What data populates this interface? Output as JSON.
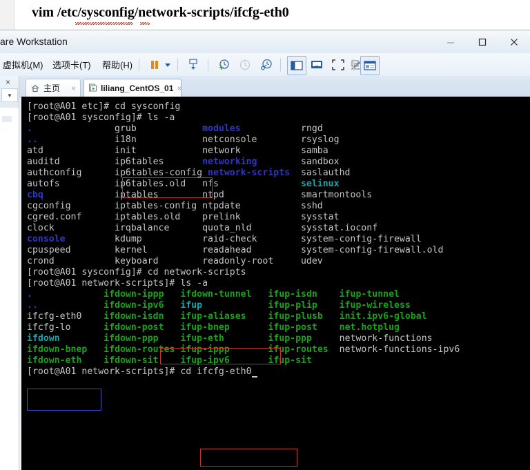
{
  "document": {
    "heading": "vim /etc/sysconfig/network-scripts/ifcfg-eth0"
  },
  "window": {
    "title": "are Workstation",
    "controls": {
      "minimize": "minimize-button",
      "maximize": "maximize-button",
      "close": "close-button"
    }
  },
  "menubar": {
    "items": [
      {
        "label": "虚拟机(M)"
      },
      {
        "label": "选项卡(T)"
      },
      {
        "label": "帮助(H)"
      }
    ],
    "toolbar_icons": [
      "pause-icon",
      "chevron-down-icon",
      "snapshot-icon",
      "take-snapshot-icon",
      "revert-snapshot-icon",
      "snapshot-manager-icon",
      "show-library-icon",
      "fit-window-icon",
      "full-screen-icon",
      "unity-mode-icon",
      "console-view-icon"
    ]
  },
  "tabs": [
    {
      "label": "主页",
      "icon": "home-icon",
      "close": "×",
      "active": false
    },
    {
      "label": "liliang_CentOS_01",
      "icon": "vm-icon",
      "close": "×",
      "active": true
    }
  ],
  "sidebar": {
    "close_label": "×",
    "dropdown_label": "▼"
  },
  "terminal": {
    "rows": [
      [
        {
          "t": "[root@A01 etc]# ",
          "c": "w"
        },
        {
          "t": "cd sysconfig",
          "c": "w"
        }
      ],
      [
        {
          "t": "[root@A01 sysconfig]# ls -a",
          "c": "w"
        }
      ],
      [
        {
          "t": ".",
          "c": "b"
        },
        {
          "t": "               grub            ",
          "c": "w"
        },
        {
          "t": "modules",
          "c": "b"
        },
        {
          "t": "           rngd",
          "c": "w"
        }
      ],
      [
        {
          "t": "..",
          "c": "b"
        },
        {
          "t": "              i18n            netconsole        rsyslog",
          "c": "w"
        }
      ],
      [
        {
          "t": "atd             init            network           samba",
          "c": "w"
        }
      ],
      [
        {
          "t": "auditd          ip6tables       ",
          "c": "w"
        },
        {
          "t": "networking",
          "c": "b"
        },
        {
          "t": "        sandbox",
          "c": "w"
        }
      ],
      [
        {
          "t": "authconfig      ip6tables-config ",
          "c": "w"
        },
        {
          "t": "network-scripts",
          "c": "b"
        },
        {
          "t": "  saslauthd",
          "c": "w"
        }
      ],
      [
        {
          "t": "autofs          ip6tables.old   nfs               ",
          "c": "w"
        },
        {
          "t": "selinux",
          "c": "c"
        }
      ],
      [
        {
          "t": "cbq",
          "c": "b"
        },
        {
          "t": "             iptables        ntpd              smartmontools",
          "c": "w"
        }
      ],
      [
        {
          "t": "cgconfig        iptables-config ntpdate           sshd",
          "c": "w"
        }
      ],
      [
        {
          "t": "cgred.conf      iptables.old    prelink           sysstat",
          "c": "w"
        }
      ],
      [
        {
          "t": "clock           irqbalance      quota_nld         sysstat.ioconf",
          "c": "w"
        }
      ],
      [
        {
          "t": "console",
          "c": "b"
        },
        {
          "t": "         kdump           raid-check        system-config-firewall",
          "c": "w"
        }
      ],
      [
        {
          "t": "cpuspeed        kernel          readahead         system-config-firewall.old",
          "c": "w"
        }
      ],
      [
        {
          "t": "crond           keyboard        readonly-root     udev",
          "c": "w"
        }
      ],
      [
        {
          "t": "[root@A01 sysconfig]# ",
          "c": "w"
        },
        {
          "t": "cd network-scripts",
          "c": "w"
        }
      ],
      [
        {
          "t": "[root@A01 network-scripts]# ls -a",
          "c": "w"
        }
      ],
      [
        {
          "t": ".",
          "c": "b"
        },
        {
          "t": "             ",
          "c": "w"
        },
        {
          "t": "ifdown-ippp",
          "c": "g"
        },
        {
          "t": "   ",
          "c": "w"
        },
        {
          "t": "ifdown-tunnel",
          "c": "g"
        },
        {
          "t": "   ",
          "c": "w"
        },
        {
          "t": "ifup-isdn",
          "c": "g"
        },
        {
          "t": "    ",
          "c": "w"
        },
        {
          "t": "ifup-tunnel",
          "c": "g"
        }
      ],
      [
        {
          "t": "..",
          "c": "b"
        },
        {
          "t": "            ",
          "c": "w"
        },
        {
          "t": "ifdown-ipv6",
          "c": "g"
        },
        {
          "t": "   ",
          "c": "w"
        },
        {
          "t": "ifup",
          "c": "c"
        },
        {
          "t": "            ",
          "c": "w"
        },
        {
          "t": "ifup-plip",
          "c": "g"
        },
        {
          "t": "    ",
          "c": "w"
        },
        {
          "t": "ifup-wireless",
          "c": "g"
        }
      ],
      [
        {
          "t": "ifcfg-eth0",
          "c": "w"
        },
        {
          "t": "    ",
          "c": "w"
        },
        {
          "t": "ifdown-isdn",
          "c": "g"
        },
        {
          "t": "   ",
          "c": "w"
        },
        {
          "t": "ifup-aliases",
          "c": "g"
        },
        {
          "t": "    ",
          "c": "w"
        },
        {
          "t": "ifup-plusb",
          "c": "g"
        },
        {
          "t": "   ",
          "c": "w"
        },
        {
          "t": "init.ipv6-global",
          "c": "g"
        }
      ],
      [
        {
          "t": "ifcfg-lo",
          "c": "w"
        },
        {
          "t": "      ",
          "c": "w"
        },
        {
          "t": "ifdown-post",
          "c": "g"
        },
        {
          "t": "   ",
          "c": "w"
        },
        {
          "t": "ifup-bnep",
          "c": "g"
        },
        {
          "t": "       ",
          "c": "w"
        },
        {
          "t": "ifup-post",
          "c": "g"
        },
        {
          "t": "    ",
          "c": "w"
        },
        {
          "t": "net.hotplug",
          "c": "g"
        }
      ],
      [
        {
          "t": "ifdown",
          "c": "c"
        },
        {
          "t": "        ",
          "c": "w"
        },
        {
          "t": "ifdown-ppp",
          "c": "g"
        },
        {
          "t": "    ",
          "c": "w"
        },
        {
          "t": "ifup-eth",
          "c": "g"
        },
        {
          "t": "        ",
          "c": "w"
        },
        {
          "t": "ifup-ppp",
          "c": "g"
        },
        {
          "t": "     ",
          "c": "w"
        },
        {
          "t": "network-functions",
          "c": "w"
        }
      ],
      [
        {
          "t": "ifdown-bnep",
          "c": "g"
        },
        {
          "t": "   ",
          "c": "w"
        },
        {
          "t": "ifdown-routes",
          "c": "g"
        },
        {
          "t": " ",
          "c": "w"
        },
        {
          "t": "ifup-ippp",
          "c": "g"
        },
        {
          "t": "       ",
          "c": "w"
        },
        {
          "t": "ifup-routes",
          "c": "g"
        },
        {
          "t": "  ",
          "c": "w"
        },
        {
          "t": "network-functions-ipv6",
          "c": "w"
        }
      ],
      [
        {
          "t": "ifdown-eth",
          "c": "g"
        },
        {
          "t": "    ",
          "c": "w"
        },
        {
          "t": "ifdown-sit",
          "c": "g"
        },
        {
          "t": "    ",
          "c": "w"
        },
        {
          "t": "ifup-ipv6",
          "c": "g"
        },
        {
          "t": "       ",
          "c": "w"
        },
        {
          "t": "ifup-sit",
          "c": "g"
        }
      ],
      [
        {
          "t": "[root@A01 network-scripts]# ",
          "c": "w"
        },
        {
          "t": "cd ifcfg-eth0",
          "c": "w"
        },
        {
          "t": "CURSOR",
          "c": "cur"
        }
      ]
    ],
    "annotations": [
      {
        "name": "highlight-cd-sysconfig",
        "color": "#c0392b",
        "target": "cd sysconfig"
      },
      {
        "name": "highlight-cd-network-scripts",
        "color": "#c0392b",
        "target": "cd network-scripts"
      },
      {
        "name": "highlight-cd-ifcfg-eth0",
        "color": "#c0392b",
        "target": "cd ifcfg-eth0"
      },
      {
        "name": "highlight-ifcfg-eth0-file",
        "color": "#3b4fc8",
        "target": "ifcfg-eth0"
      }
    ]
  },
  "colors": {
    "terminal_bg": "#000000",
    "text_white": "#c6c6c6",
    "text_blue": "#2f36c8",
    "text_green": "#17a317",
    "text_cyan": "#11a8ab",
    "annotation_red": "#c0392b",
    "annotation_blue": "#3b4fc8"
  }
}
